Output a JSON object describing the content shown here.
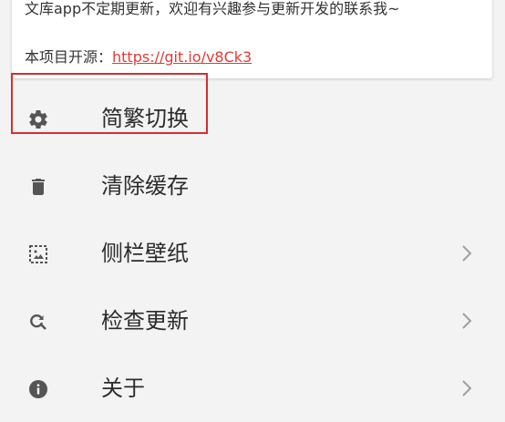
{
  "about_card": {
    "line1": "文库app不定期更新，欢迎有兴趣参与更新开发的联系我~",
    "open_source_prefix": "本项目开源：",
    "open_source_link": "https://git.io/v8Ck3"
  },
  "menu": {
    "items": [
      {
        "label": "简繁切换",
        "icon": "gear-icon",
        "has_chevron": false
      },
      {
        "label": "清除缓存",
        "icon": "trash-icon",
        "has_chevron": false,
        "highlighted": true
      },
      {
        "label": "侧栏壁纸",
        "icon": "image-icon",
        "has_chevron": true
      },
      {
        "label": "检查更新",
        "icon": "search-refresh-icon",
        "has_chevron": true
      },
      {
        "label": "关于",
        "icon": "info-icon",
        "has_chevron": true
      }
    ]
  },
  "colors": {
    "background": "#f3f3f3",
    "card": "#ffffff",
    "link": "#e53935",
    "highlight_border": "#d32f2f",
    "icon": "#555555",
    "chevron": "#9e9e9e"
  }
}
